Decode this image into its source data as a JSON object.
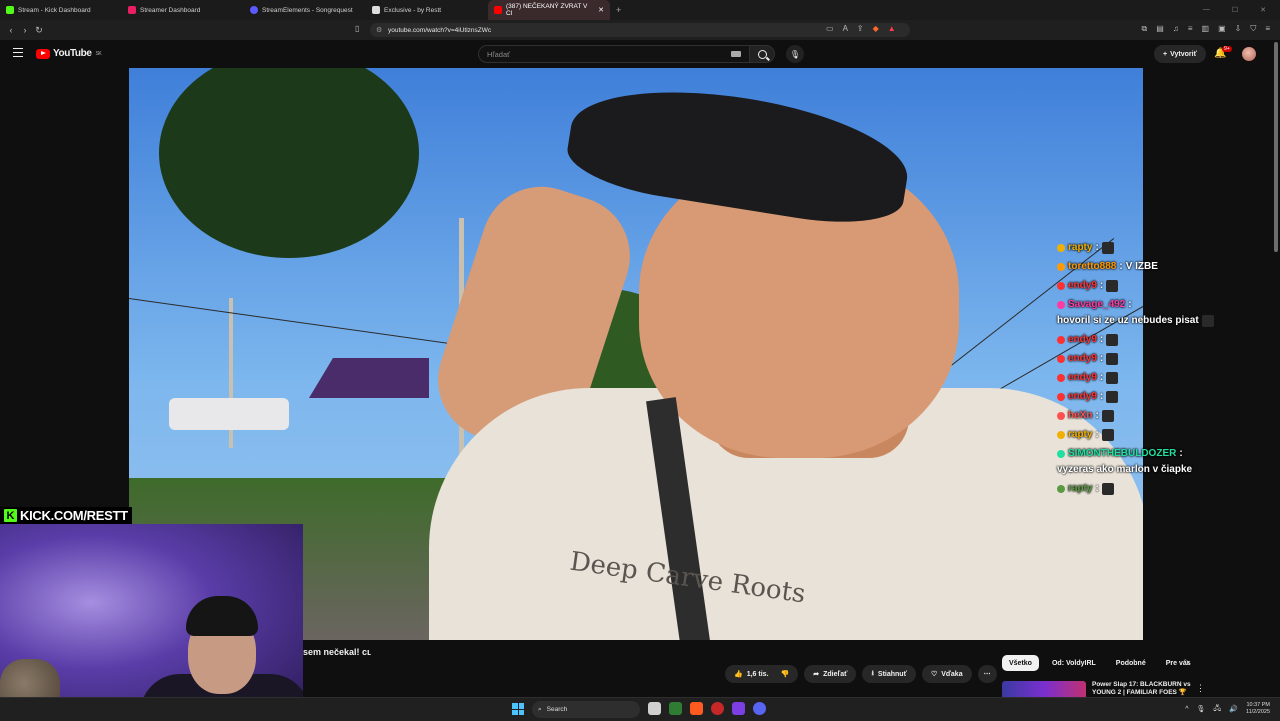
{
  "browser": {
    "tabs": [
      {
        "label": "Stream - Kick Dashboard",
        "color": "#53fc18",
        "active": false
      },
      {
        "label": "Streamer Dashboard",
        "color": "#e91e63",
        "active": false
      },
      {
        "label": "StreamElements - Songrequest",
        "color": "#5a5aff",
        "active": false
      },
      {
        "label": "Exclusive - by Restt",
        "color": "#dddddd",
        "active": false
      },
      {
        "label": "(387) NEČEKANÝ ZVRAT V CI",
        "color": "#ff0000",
        "active": true
      }
    ],
    "new_tab_symbol": "+",
    "url": "youtube.com/watch?v=4iUtlznsZWc"
  },
  "youtube": {
    "logo_text": "YouTube",
    "logo_region": "SK",
    "search_placeholder": "Hľadať",
    "create_label": "Vytvoriť",
    "notification_count": "9+"
  },
  "chat": [
    {
      "user": "rapty",
      "color": "#f0b000",
      "message": "",
      "has_emote": true
    },
    {
      "user": "toretto888",
      "color": "#ff9a00",
      "message": "V IZBE",
      "has_emote": false
    },
    {
      "user": "endy9",
      "color": "#ff3030",
      "message": "",
      "has_emote": true
    },
    {
      "user": "Savage_492",
      "color": "#ff3aa0",
      "message": "hovoril si ze uz nebudes pisat",
      "has_emote": true
    },
    {
      "user": "endy9",
      "color": "#ff3030",
      "message": "",
      "has_emote": true
    },
    {
      "user": "endy9",
      "color": "#ff3030",
      "message": "",
      "has_emote": true
    },
    {
      "user": "endy9",
      "color": "#ff3030",
      "message": "",
      "has_emote": true
    },
    {
      "user": "endy9",
      "color": "#ff3030",
      "message": "",
      "has_emote": true
    },
    {
      "user": "heXn",
      "color": "#ff5050",
      "message": "",
      "has_emote": true
    },
    {
      "user": "rapty",
      "color": "#f0b000",
      "message": "",
      "has_emote": true
    },
    {
      "user": "SIMONTHEBULDOZER",
      "color": "#20e0a0",
      "message": "vyzeras ako marlon v čiapke",
      "has_emote": false
    },
    {
      "user": "rapty",
      "color": "#5a9a40",
      "message": "",
      "has_emote": true
    }
  ],
  "overlay": {
    "kick_letter": "K",
    "kick_text": "KICK.COM/RESTT"
  },
  "video": {
    "title": "sem nečekal! cʟ",
    "shirt_print": "Deep Carve Roots",
    "likes": "1,6 tis.",
    "share_label": "Zdieľať",
    "download_label": "Stiahnuť",
    "thanks_label": "Vďaka",
    "more_symbol": "⋯"
  },
  "sidebar": {
    "filters": [
      "Všetko",
      "Od: VoldyIRL",
      "Podobné",
      "Pre vás"
    ],
    "recommendation_title": "Power Slap 17: BLACKBURN vs YOUNG 2 | FAMILIAR FOES 🏆"
  },
  "taskbar": {
    "search_label": "Search",
    "time": "10:37 PM",
    "date": "11/2/2025"
  }
}
